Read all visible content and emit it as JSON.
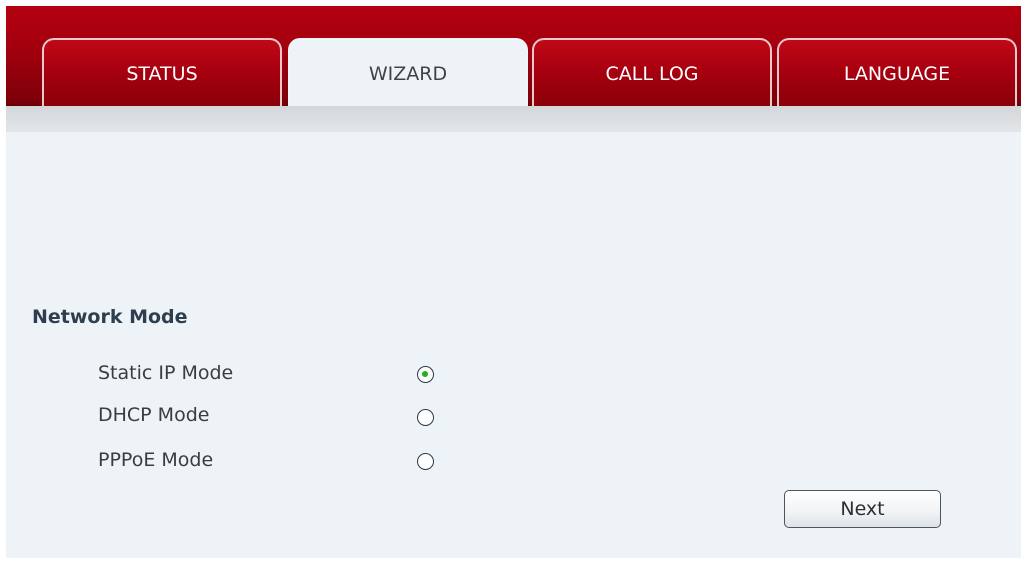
{
  "tabs": [
    {
      "label": "STATUS",
      "active": false
    },
    {
      "label": "WIZARD",
      "active": true
    },
    {
      "label": "CALL LOG",
      "active": false
    },
    {
      "label": "LANGUAGE",
      "active": false
    }
  ],
  "network_mode": {
    "title": "Network Mode",
    "options": [
      {
        "label": "Static IP Mode",
        "selected": true
      },
      {
        "label": "DHCP Mode",
        "selected": false
      },
      {
        "label": "PPPoE Mode",
        "selected": false
      }
    ]
  },
  "actions": {
    "next_label": "Next"
  },
  "colors": {
    "header_red": "#a2000f",
    "background": "#eef3f7",
    "radio_selected": "#22b022",
    "title_text": "#2d3f4f"
  }
}
